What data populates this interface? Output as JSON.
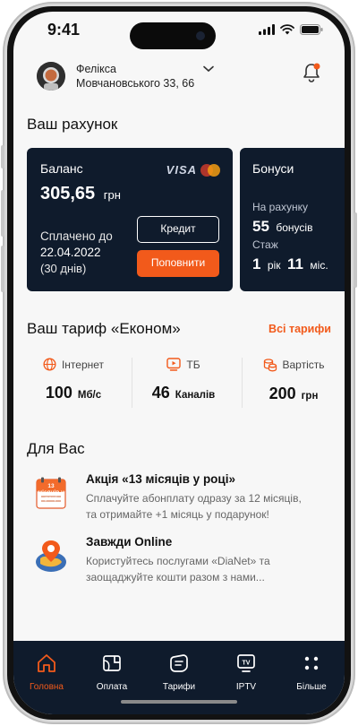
{
  "status": {
    "time": "9:41"
  },
  "header": {
    "name": "Феліксa",
    "address": "Мовчановського 33, 66"
  },
  "account": {
    "title": "Ваш рахунок",
    "balance_card": {
      "label": "Баланс",
      "visa": "VISA",
      "amount": "305,65",
      "currency": "грн",
      "paid_until_label": "Сплачено до",
      "paid_until_date": "22.04.2022",
      "days": "(30 днів)",
      "credit_button": "Кредит",
      "topup_button": "Поповнити"
    },
    "bonus_card": {
      "label": "Бонуси",
      "on_account_label": "На рахунку",
      "bonus_value": "55",
      "bonus_unit": "бонусів",
      "tenure_label": "Стаж",
      "years": "1",
      "years_unit": "рік",
      "months": "11",
      "months_unit": "міс."
    }
  },
  "tariff": {
    "title": "Ваш тариф «Економ»",
    "all_link": "Всі тарифи",
    "stats": [
      {
        "label": "Інтернет",
        "value": "100",
        "unit": "Мб/с",
        "icon": "globe-icon"
      },
      {
        "label": "ТБ",
        "value": "46",
        "unit": "Каналів",
        "icon": "tv-play-icon"
      },
      {
        "label": "Вартість",
        "value": "200",
        "unit": "грн",
        "icon": "coins-icon"
      }
    ]
  },
  "for_you": {
    "title": "Для Вас",
    "promos": [
      {
        "title": "Акція «13 місяців у році»",
        "text1": "Сплачуйте абонплату одразу за 12 місяців,",
        "text2": "та отримайте +1 місяць у подарунок!",
        "icon_text": "13 місяців у році"
      },
      {
        "title": "Завжди Online",
        "text1": "Користуйтесь послугами «DiaNet» та",
        "text2": "заощаджуйте кошти разом з нами..."
      }
    ]
  },
  "nav": {
    "items": [
      {
        "label": "Головна",
        "icon": "home-icon"
      },
      {
        "label": "Оплата",
        "icon": "wallet-icon"
      },
      {
        "label": "Тарифи",
        "icon": "tariffs-icon"
      },
      {
        "label": "IPTV",
        "icon": "tv-icon"
      },
      {
        "label": "Більше",
        "icon": "more-dots-icon"
      }
    ]
  },
  "colors": {
    "accent": "#f25a1b",
    "card_bg": "#0f1b2c",
    "screen_bg": "#f7f7f7"
  }
}
